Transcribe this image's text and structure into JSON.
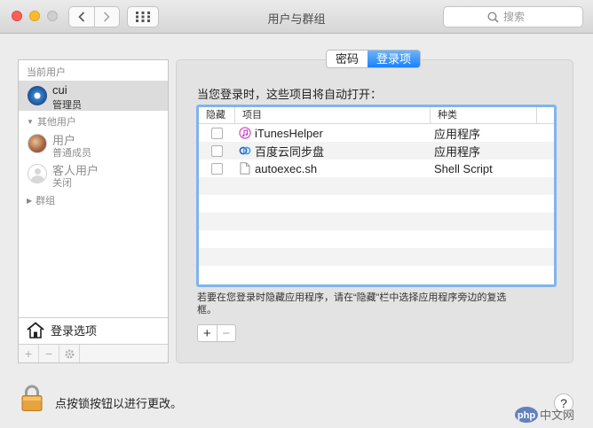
{
  "window": {
    "title": "用户与群组",
    "search_placeholder": "搜索"
  },
  "sidebar": {
    "current_users_header": "当前用户",
    "current_user": {
      "name": "cui",
      "role": "管理员"
    },
    "other_users_header": "其他用户",
    "other_users": [
      {
        "name": "用户",
        "role": "普通成员"
      },
      {
        "name": "客人用户",
        "role": "关闭"
      }
    ],
    "groups_header": "群组",
    "login_options": "登录选项"
  },
  "tabs": [
    {
      "label": "密码",
      "active": false
    },
    {
      "label": "登录项",
      "active": true
    }
  ],
  "main": {
    "label": "当您登录时，这些项目将自动打开：",
    "table": {
      "columns": [
        "隐藏",
        "项目",
        "种类"
      ],
      "rows": [
        {
          "hidden": false,
          "item": "iTunesHelper",
          "kind": "应用程序",
          "icon": "itunes-icon"
        },
        {
          "hidden": false,
          "item": "百度云同步盘",
          "kind": "应用程序",
          "icon": "baidu-cloud-icon"
        },
        {
          "hidden": false,
          "item": "autoexec.sh",
          "kind": "Shell Script",
          "icon": "document-icon"
        }
      ]
    },
    "help_text": "若要在您登录时隐藏应用程序，请在“隐藏”栏中选择应用程序旁边的复选框。"
  },
  "footer": {
    "lock_text": "点按锁按钮以进行更改。",
    "help": "?",
    "watermark": "php中文网"
  },
  "colors": {
    "accent": "#1a82fb",
    "selection": "#dcdcdc",
    "table_focus": "#80b4ec"
  }
}
